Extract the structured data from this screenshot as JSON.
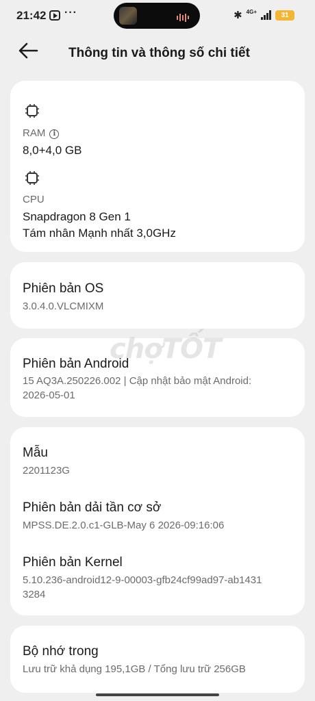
{
  "status_bar": {
    "time": "21:42",
    "more": "···",
    "network": "4G+",
    "battery": "31"
  },
  "header": {
    "title": "Thông tin và thông số chi tiết"
  },
  "hardware": {
    "ram_label": "RAM",
    "ram_value": "8,0+4,0 GB",
    "cpu_label": "CPU",
    "cpu_value_line1": "Snapdragon 8 Gen 1",
    "cpu_value_line2": "Tám nhân Mạnh nhất 3,0GHz"
  },
  "os": {
    "title": "Phiên bản OS",
    "value": "3.0.4.0.VLCMIXM"
  },
  "android": {
    "title": "Phiên bản Android",
    "value_line1": "15 AQ3A.250226.002 | Cập nhật bảo mật Android:",
    "value_line2": "2026-05-01"
  },
  "device": {
    "model_title": "Mẫu",
    "model_value": "2201123G",
    "baseband_title": "Phiên bản dải tần cơ sở",
    "baseband_value": "MPSS.DE.2.0.c1-GLB-May  6 2026-09:16:06",
    "kernel_title": "Phiên bản Kernel",
    "kernel_value_line1": "5.10.236-android12-9-00003-gfb24cf99ad97-ab1431",
    "kernel_value_line2": "3284"
  },
  "storage": {
    "title": "Bộ nhớ trong",
    "value": "Lưu trữ khả dụng  195,1GB / Tổng lưu trữ  256GB"
  },
  "watermark": "chợTỐT",
  "icons": {
    "back": "arrow-left-icon",
    "ram": "chip-icon",
    "cpu": "processor-icon",
    "info": "info-icon"
  },
  "colors": {
    "background": "#efefef",
    "card": "#ffffff",
    "battery": "#f2b632",
    "secondary_text": "#6b6b6b"
  }
}
